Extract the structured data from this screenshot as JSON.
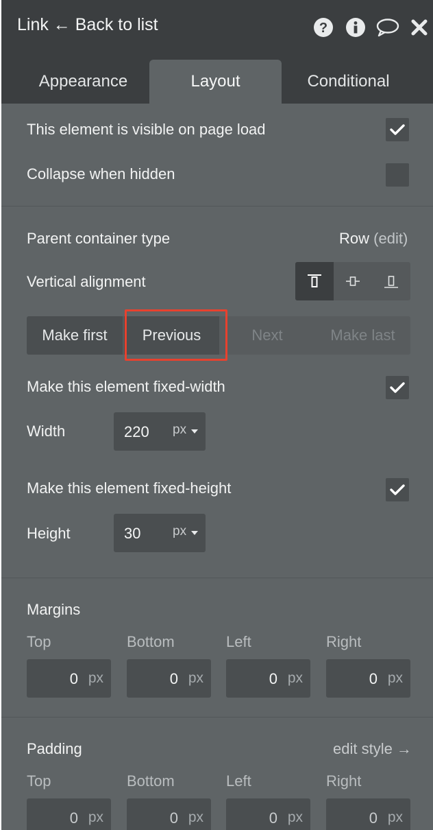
{
  "header": {
    "title": "Link ← Back to list",
    "icons": [
      "help-icon",
      "info-icon",
      "comment-icon",
      "close-icon"
    ]
  },
  "tabs": [
    {
      "label": "Appearance",
      "active": false
    },
    {
      "label": "Layout",
      "active": true
    },
    {
      "label": "Conditional",
      "active": false
    }
  ],
  "visibility": {
    "visible_on_load_label": "This element is visible on page load",
    "visible_on_load_checked": true,
    "collapse_label": "Collapse when hidden",
    "collapse_checked": false
  },
  "container": {
    "type_label": "Parent container type",
    "type_value": "Row",
    "edit_link": "(edit)",
    "vertical_alignment_label": "Vertical alignment",
    "vertical_alignment_options": [
      "align-top-icon",
      "align-middle-icon",
      "align-bottom-icon"
    ],
    "vertical_alignment_selected": 0
  },
  "order_buttons": {
    "make_first": "Make first",
    "previous": "Previous",
    "next": "Next",
    "make_last": "Make last"
  },
  "size": {
    "fixed_width_label": "Make this element fixed-width",
    "fixed_width_checked": true,
    "width_label": "Width",
    "width_value": "220",
    "width_unit": "px",
    "fixed_height_label": "Make this element fixed-height",
    "fixed_height_checked": true,
    "height_label": "Height",
    "height_value": "30",
    "height_unit": "px"
  },
  "margins": {
    "title": "Margins",
    "top_label": "Top",
    "bottom_label": "Bottom",
    "left_label": "Left",
    "right_label": "Right",
    "top": "0",
    "bottom": "0",
    "left": "0",
    "right": "0",
    "unit": "px"
  },
  "padding": {
    "title": "Padding",
    "edit_style_link": "edit style →",
    "top_label": "Top",
    "bottom_label": "Bottom",
    "left_label": "Left",
    "right_label": "Right",
    "top": "0",
    "bottom": "0",
    "left": "0",
    "right": "0",
    "unit": "px"
  },
  "colors": {
    "panel_bg": "#5f6466",
    "header_bg": "#3b3e40",
    "input_bg": "#4a4e50",
    "highlight": "#e8412e"
  }
}
